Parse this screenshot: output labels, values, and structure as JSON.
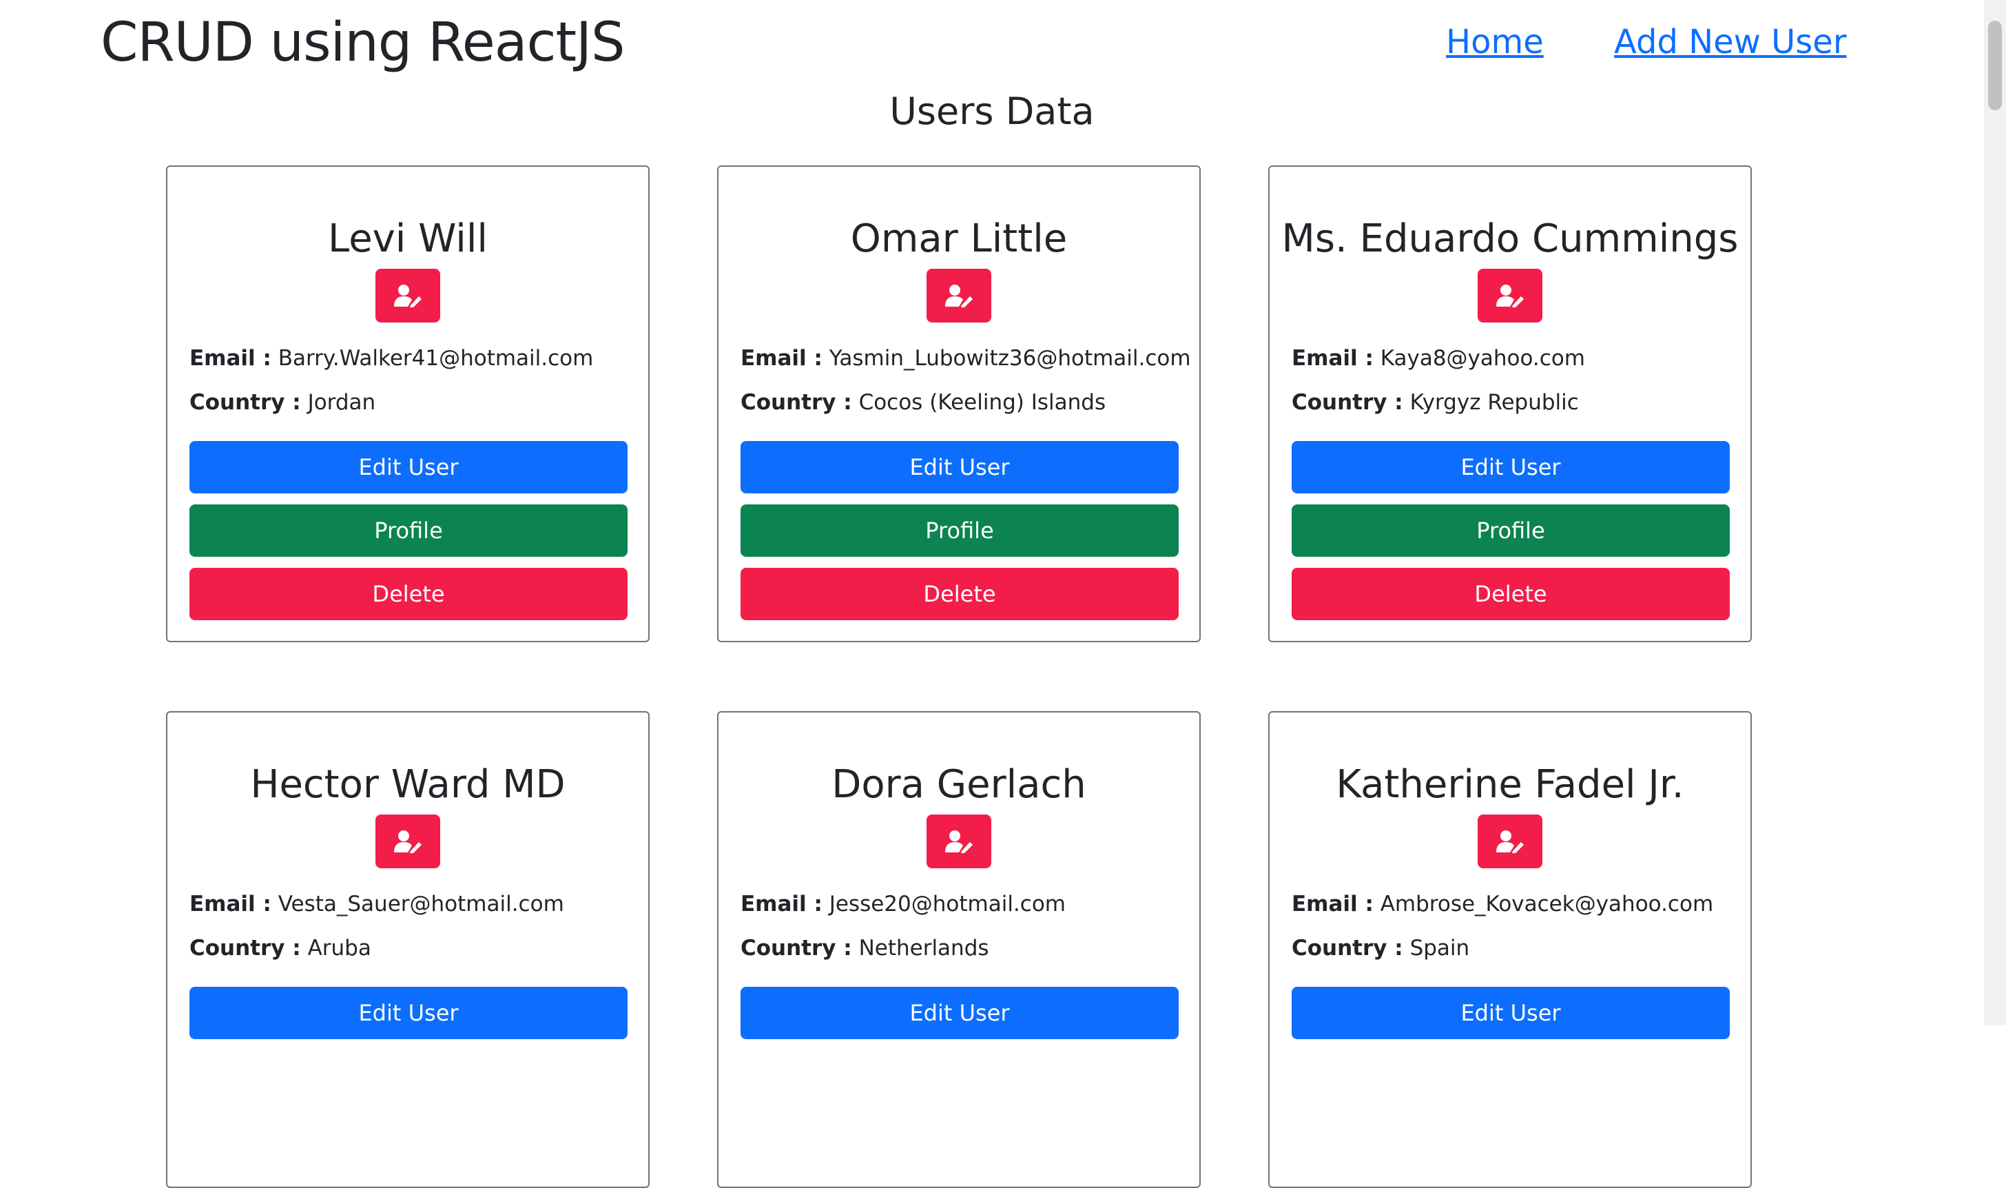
{
  "header": {
    "title": "CRUD using ReactJS",
    "nav": {
      "home": "Home",
      "add_user": "Add New User"
    }
  },
  "page": {
    "subtitle": "Users Data"
  },
  "labels": {
    "email": "Email :",
    "country": "Country :"
  },
  "buttons": {
    "edit": "Edit User",
    "profile": "Profile",
    "delete": "Delete"
  },
  "colors": {
    "primary": "#0d6efd",
    "success": "#0b8451",
    "danger": "#f31d4a",
    "link": "#0d6efd"
  },
  "users": [
    {
      "name": "Levi Will",
      "email": "Barry.Walker41@hotmail.com",
      "country": "Jordan"
    },
    {
      "name": "Omar Little",
      "email": "Yasmin_Lubowitz36@hotmail.com",
      "country": "Cocos (Keeling) Islands"
    },
    {
      "name": "Ms. Eduardo Cummings",
      "email": "Kaya8@yahoo.com",
      "country": "Kyrgyz Republic"
    },
    {
      "name": "Hector Ward MD",
      "email": "Vesta_Sauer@hotmail.com",
      "country": "Aruba"
    },
    {
      "name": "Dora Gerlach",
      "email": "Jesse20@hotmail.com",
      "country": "Netherlands"
    },
    {
      "name": "Katherine Fadel Jr.",
      "email": "Ambrose_Kovacek@yahoo.com",
      "country": "Spain"
    }
  ]
}
